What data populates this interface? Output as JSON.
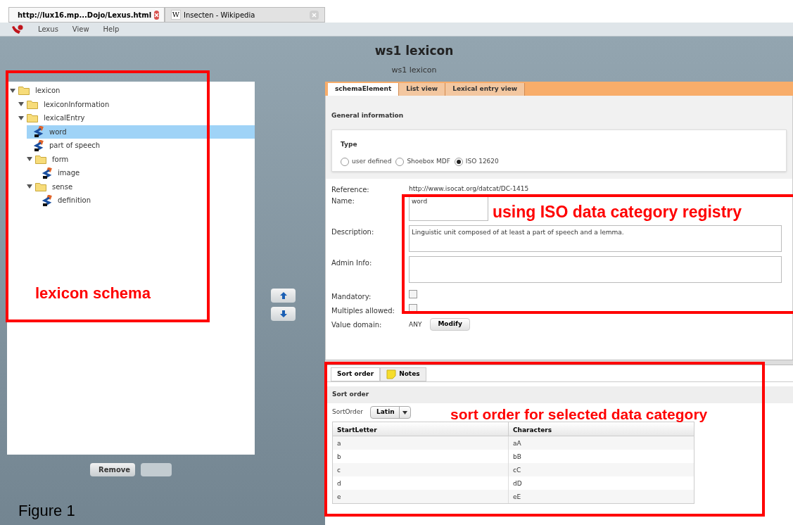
{
  "browser_tabs": [
    {
      "label": "http://lux16.mp...Dojo/Lexus.html",
      "kind": "page",
      "selected": true
    },
    {
      "label": "Insecten - Wikipedia",
      "kind": "wiki",
      "icon_text": "W",
      "selected": false
    }
  ],
  "menu": [
    "Lexus",
    "View",
    "Help"
  ],
  "header": {
    "title": "ws1 lexicon",
    "subtitle": "ws1 lexicon"
  },
  "tree": [
    {
      "label": "lexicon",
      "kind": "folder",
      "expanded": true,
      "selected": false,
      "children": [
        {
          "label": "lexiconInformation",
          "kind": "folder",
          "expanded": true,
          "selected": false
        },
        {
          "label": "lexicalEntry",
          "kind": "folder",
          "expanded": true,
          "selected": false,
          "children": [
            {
              "label": "word",
              "kind": "element",
              "selected": true
            },
            {
              "label": "part of speech",
              "kind": "element",
              "selected": false
            },
            {
              "label": "form",
              "kind": "folder",
              "expanded": true,
              "selected": false,
              "children": [
                {
                  "label": "image",
                  "kind": "element",
                  "selected": false
                }
              ]
            },
            {
              "label": "sense",
              "kind": "folder",
              "expanded": true,
              "selected": false,
              "children": [
                {
                  "label": "definition",
                  "kind": "element",
                  "selected": false
                }
              ]
            }
          ]
        }
      ]
    }
  ],
  "tree_buttons": [
    {
      "label": "Remove",
      "disabled": false
    },
    {
      "disabled": true
    }
  ],
  "editor_tabs": [
    {
      "label": "schemaElement",
      "selected": true
    },
    {
      "label": "List view",
      "selected": false
    },
    {
      "label": "Lexical entry view",
      "selected": false
    }
  ],
  "general": {
    "heading": "General information",
    "type_heading": "Type",
    "types": [
      {
        "label": "user defined",
        "selected": false
      },
      {
        "label": "Shoebox MDF",
        "selected": false
      },
      {
        "label": "ISO 12620",
        "selected": true
      }
    ],
    "reference_label": "Reference:",
    "reference": "http://www.isocat.org/datcat/DC-1415",
    "name_label": "Name:",
    "name": "word",
    "description_label": "Description:",
    "description": "Linguistic unit composed of at least a part of speech and a lemma.",
    "admin_label": "Admin Info:",
    "mandatory_label": "Mandatory:",
    "mandatory": false,
    "multiples_label": "Multiples allowed:",
    "multiples": false,
    "domain_label": "Value domain:",
    "domain": "ANY",
    "modify_button": "Modify"
  },
  "bottom_tabs": [
    {
      "label": "Sort order",
      "selected": true
    },
    {
      "label": "Notes",
      "selected": false
    }
  ],
  "sort": {
    "heading": "Sort order",
    "label": "SortOrder",
    "value": "Latin",
    "columns": [
      "StartLetter",
      "Characters"
    ],
    "rows": [
      [
        "a",
        "aA"
      ],
      [
        "b",
        "bB"
      ],
      [
        "c",
        "cC"
      ],
      [
        "d",
        "dD"
      ],
      [
        "e",
        "eE"
      ]
    ]
  },
  "annotations": [
    {
      "label": "lexicon schema"
    },
    {
      "label": "using ISO data category registry"
    },
    {
      "label": "sort order for selected data category"
    }
  ],
  "caption": "Figure 1"
}
